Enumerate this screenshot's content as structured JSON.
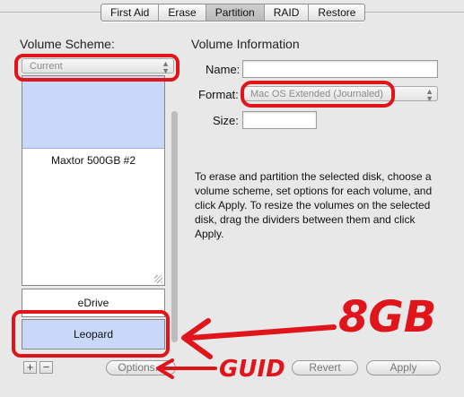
{
  "tabs": [
    "First Aid",
    "Erase",
    "Partition",
    "RAID",
    "Restore"
  ],
  "volume_scheme": {
    "label": "Volume Scheme:",
    "selected": "Current"
  },
  "volume_info": {
    "header": "Volume Information",
    "name_label": "Name:",
    "name_value": "",
    "format_label": "Format:",
    "format_value": "Mac OS Extended (Journaled)",
    "size_label": "Size:",
    "size_value": ""
  },
  "map": {
    "disk_label": "Maxtor 500GB #2",
    "volumes": [
      "eDrive",
      "Leopard"
    ]
  },
  "help_text": "To erase and partition the selected disk, choose a volume scheme, set options for each volume, and click Apply. To resize the volumes on the selected disk, drag the dividers between them and click Apply.",
  "buttons": {
    "add": "+",
    "remove": "−",
    "options": "Options...",
    "revert": "Revert",
    "apply": "Apply"
  },
  "annotations": {
    "size_note": "8GB",
    "options_note": "GUID",
    "color": "#e0141b"
  }
}
